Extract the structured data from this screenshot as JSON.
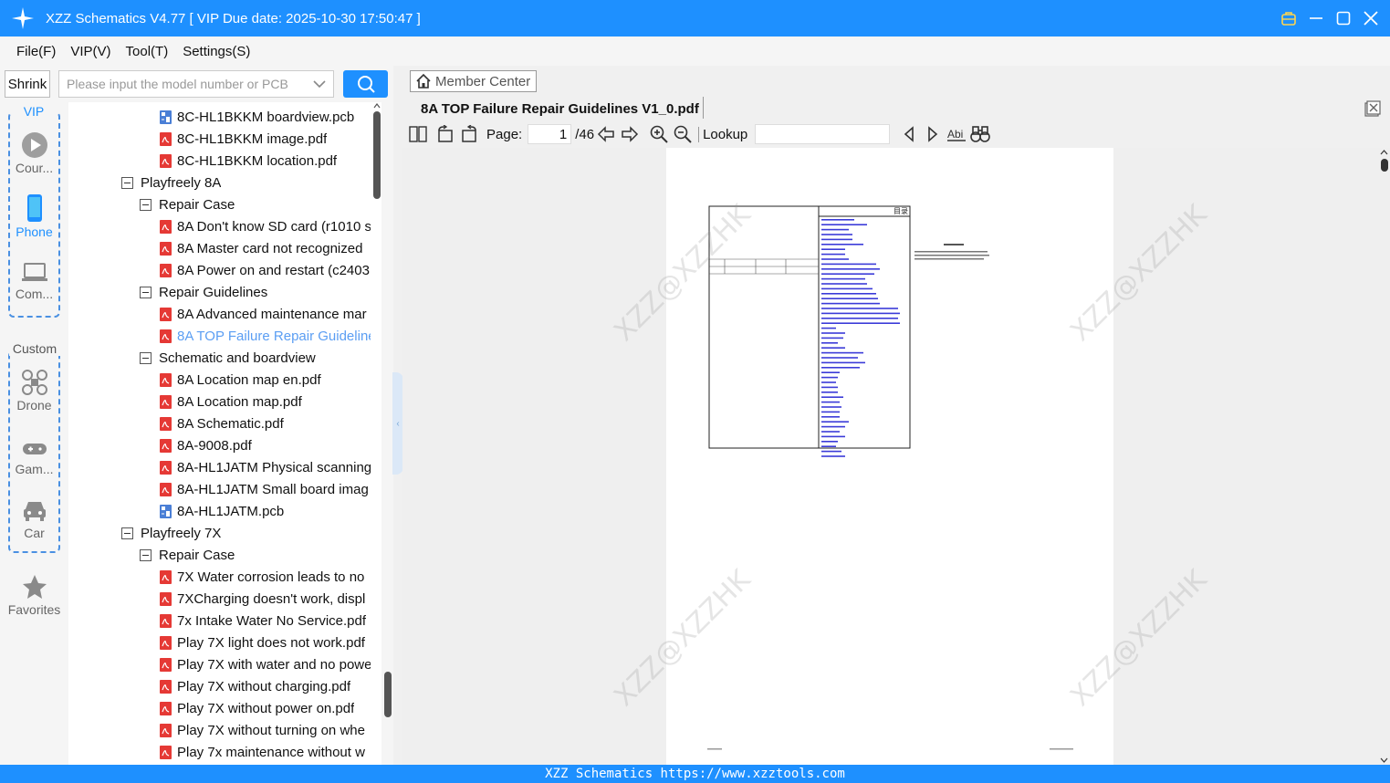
{
  "window": {
    "title": "XZZ Schematics V4.77 [ VIP Due date: 2025-10-30 17:50:47 ]"
  },
  "menu": [
    "File(F)",
    "VIP(V)",
    "Tool(T)",
    "Settings(S)"
  ],
  "sidebar": {
    "shrink_label": "Shrink",
    "vip_label": "VIP",
    "custom_label": "Custom",
    "items": [
      {
        "label": "Cour...",
        "icon": "play-circle-icon"
      },
      {
        "label": "Phone",
        "icon": "phone-icon"
      },
      {
        "label": "Com...",
        "icon": "laptop-icon"
      },
      {
        "label": "Drone",
        "icon": "drone-icon"
      },
      {
        "label": "Gam...",
        "icon": "gamepad-icon"
      },
      {
        "label": "Car",
        "icon": "car-icon"
      },
      {
        "label": "Favorites",
        "icon": "star-icon"
      }
    ]
  },
  "search": {
    "placeholder": "Please input the model number or PCB"
  },
  "tree": [
    {
      "label": "8C-HL1BKKM boardview.pcb",
      "type": "pcb",
      "level": 2
    },
    {
      "label": "8C-HL1BKKM image.pdf",
      "type": "pdf",
      "level": 2
    },
    {
      "label": "8C-HL1BKKM location.pdf",
      "type": "pdf",
      "level": 2
    },
    {
      "label": "Playfreely 8A",
      "type": "folder",
      "level": 0
    },
    {
      "label": "Repair Case",
      "type": "folder",
      "level": 1
    },
    {
      "label": "8A Don't know SD card (r1010 s",
      "type": "pdf",
      "level": 2
    },
    {
      "label": "8A Master card not recognized",
      "type": "pdf",
      "level": 2
    },
    {
      "label": "8A Power on and restart (c2403",
      "type": "pdf",
      "level": 2
    },
    {
      "label": "Repair Guidelines",
      "type": "folder",
      "level": 1
    },
    {
      "label": "8A Advanced maintenance mar",
      "type": "pdf",
      "level": 2
    },
    {
      "label": "8A TOP Failure Repair Guideline",
      "type": "pdf",
      "level": 2,
      "selected": true
    },
    {
      "label": "Schematic and boardview",
      "type": "folder",
      "level": 1
    },
    {
      "label": "8A Location map en.pdf",
      "type": "pdf",
      "level": 2
    },
    {
      "label": "8A Location map.pdf",
      "type": "pdf",
      "level": 2
    },
    {
      "label": "8A Schematic.pdf",
      "type": "pdf",
      "level": 2
    },
    {
      "label": "8A-9008.pdf",
      "type": "pdf",
      "level": 2
    },
    {
      "label": "8A-HL1JATM Physical scanning",
      "type": "pdf",
      "level": 2
    },
    {
      "label": "8A-HL1JATM Small board imag",
      "type": "pdf",
      "level": 2
    },
    {
      "label": "8A-HL1JATM.pcb",
      "type": "pcb",
      "level": 2
    },
    {
      "label": "Playfreely 7X",
      "type": "folder",
      "level": 0
    },
    {
      "label": "Repair Case",
      "type": "folder",
      "level": 1
    },
    {
      "label": "7X Water corrosion leads to no",
      "type": "pdf",
      "level": 2
    },
    {
      "label": "7XCharging doesn't work, displ",
      "type": "pdf",
      "level": 2
    },
    {
      "label": "7x Intake Water No Service.pdf",
      "type": "pdf",
      "level": 2
    },
    {
      "label": "Play 7X light does not work.pdf",
      "type": "pdf",
      "level": 2
    },
    {
      "label": "Play 7X with water and no powe",
      "type": "pdf",
      "level": 2
    },
    {
      "label": "Play 7X without charging.pdf",
      "type": "pdf",
      "level": 2
    },
    {
      "label": "Play 7X without power on.pdf",
      "type": "pdf",
      "level": 2
    },
    {
      "label": "Play 7X without turning on whe",
      "type": "pdf",
      "level": 2
    },
    {
      "label": "Play 7x maintenance without w",
      "type": "pdf",
      "level": 2
    }
  ],
  "viewer": {
    "member_center": "Member Center",
    "document_title": "8A TOP Failure Repair Guidelines V1_0.pdf",
    "page_label": "Page:",
    "page_current": "1",
    "page_total": "/46",
    "lookup_label": "Lookup",
    "lookup_value": "",
    "watermark": "XZZ@XZZHK",
    "toc_heading": "目录"
  },
  "footer": {
    "text": "XZZ Schematics https://www.xzztools.com"
  },
  "colors": {
    "accent": "#1e90ff",
    "pdf_icon": "#e53935",
    "selected_text": "#5b9ef3"
  }
}
